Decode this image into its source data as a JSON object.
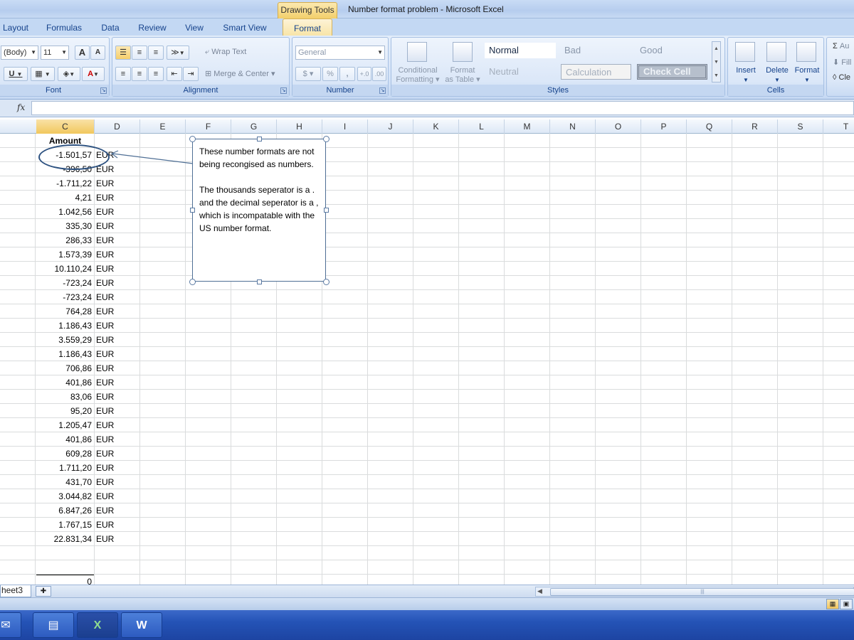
{
  "window": {
    "context_tab": "Drawing Tools",
    "title": "Number format problem - Microsoft Excel"
  },
  "ribbon_tabs": [
    "Layout",
    "Formulas",
    "Data",
    "Review",
    "View",
    "Smart View",
    "Format"
  ],
  "ribbon": {
    "font": {
      "name": "(Body)",
      "size": "11",
      "grow_icon": "A",
      "shrink_icon": "A",
      "underline": "U",
      "font_color_glyph": "A",
      "label": "Font"
    },
    "alignment": {
      "wrap_text": "Wrap Text",
      "merge_center": "Merge & Center",
      "label": "Alignment"
    },
    "number": {
      "format": "General",
      "percent": "%",
      "comma": ",",
      "inc_decimal": "+.0",
      "dec_decimal": ".00",
      "label": "Number"
    },
    "styles": {
      "conditional_formatting_1": "Conditional",
      "conditional_formatting_2": "Formatting",
      "format_as_table_1": "Format",
      "format_as_table_2": "as Table",
      "normal": "Normal",
      "bad": "Bad",
      "good": "Good",
      "neutral": "Neutral",
      "calculation": "Calculation",
      "check_cell": "Check Cell",
      "label": "Styles"
    },
    "cells": {
      "insert": "Insert",
      "delete": "Delete",
      "format": "Format",
      "label": "Cells"
    },
    "editing": {
      "autosum": "Au",
      "fill": "Fill",
      "clear": "Cle"
    }
  },
  "formula_bar": {
    "fx": "fx",
    "value": ""
  },
  "columns": [
    "C",
    "D",
    "E",
    "F",
    "G",
    "H",
    "I",
    "J",
    "K",
    "L",
    "M",
    "N",
    "O",
    "P",
    "Q",
    "R",
    "S",
    "T"
  ],
  "sheet": {
    "amount_header": "Amount",
    "rows": [
      {
        "amount": "-1.501,57",
        "currency": "EUR"
      },
      {
        "amount": "-396,50",
        "currency": "EUR"
      },
      {
        "amount": "-1.711,22",
        "currency": "EUR"
      },
      {
        "amount": "4,21",
        "currency": "EUR"
      },
      {
        "amount": "1.042,56",
        "currency": "EUR"
      },
      {
        "amount": "335,30",
        "currency": "EUR"
      },
      {
        "amount": "286,33",
        "currency": "EUR"
      },
      {
        "amount": "1.573,39",
        "currency": "EUR"
      },
      {
        "amount": "10.110,24",
        "currency": "EUR"
      },
      {
        "amount": "-723,24",
        "currency": "EUR"
      },
      {
        "amount": "-723,24",
        "currency": "EUR"
      },
      {
        "amount": "764,28",
        "currency": "EUR"
      },
      {
        "amount": "1.186,43",
        "currency": "EUR"
      },
      {
        "amount": "3.559,29",
        "currency": "EUR"
      },
      {
        "amount": "1.186,43",
        "currency": "EUR"
      },
      {
        "amount": "706,86",
        "currency": "EUR"
      },
      {
        "amount": "401,86",
        "currency": "EUR"
      },
      {
        "amount": "83,06",
        "currency": "EUR"
      },
      {
        "amount": "95,20",
        "currency": "EUR"
      },
      {
        "amount": "1.205,47",
        "currency": "EUR"
      },
      {
        "amount": "401,86",
        "currency": "EUR"
      },
      {
        "amount": "609,28",
        "currency": "EUR"
      },
      {
        "amount": "1.711,20",
        "currency": "EUR"
      },
      {
        "amount": "431,70",
        "currency": "EUR"
      },
      {
        "amount": "3.044,82",
        "currency": "EUR"
      },
      {
        "amount": "6.847,26",
        "currency": "EUR"
      },
      {
        "amount": "1.767,15",
        "currency": "EUR"
      },
      {
        "amount": "22.831,34",
        "currency": "EUR"
      }
    ],
    "sum": "0"
  },
  "callout": {
    "paragraph1": "These number formats are not being recongised as numbers.",
    "paragraph2": "The thousands seperator is a . and the decimal seperator is a , which is incompatable with the US number format."
  },
  "sheet_tabs": {
    "active": "heet3"
  },
  "colors": {
    "accent": "#15428b",
    "ellipse": "#2c5180",
    "taskbar": "#2453b6"
  }
}
